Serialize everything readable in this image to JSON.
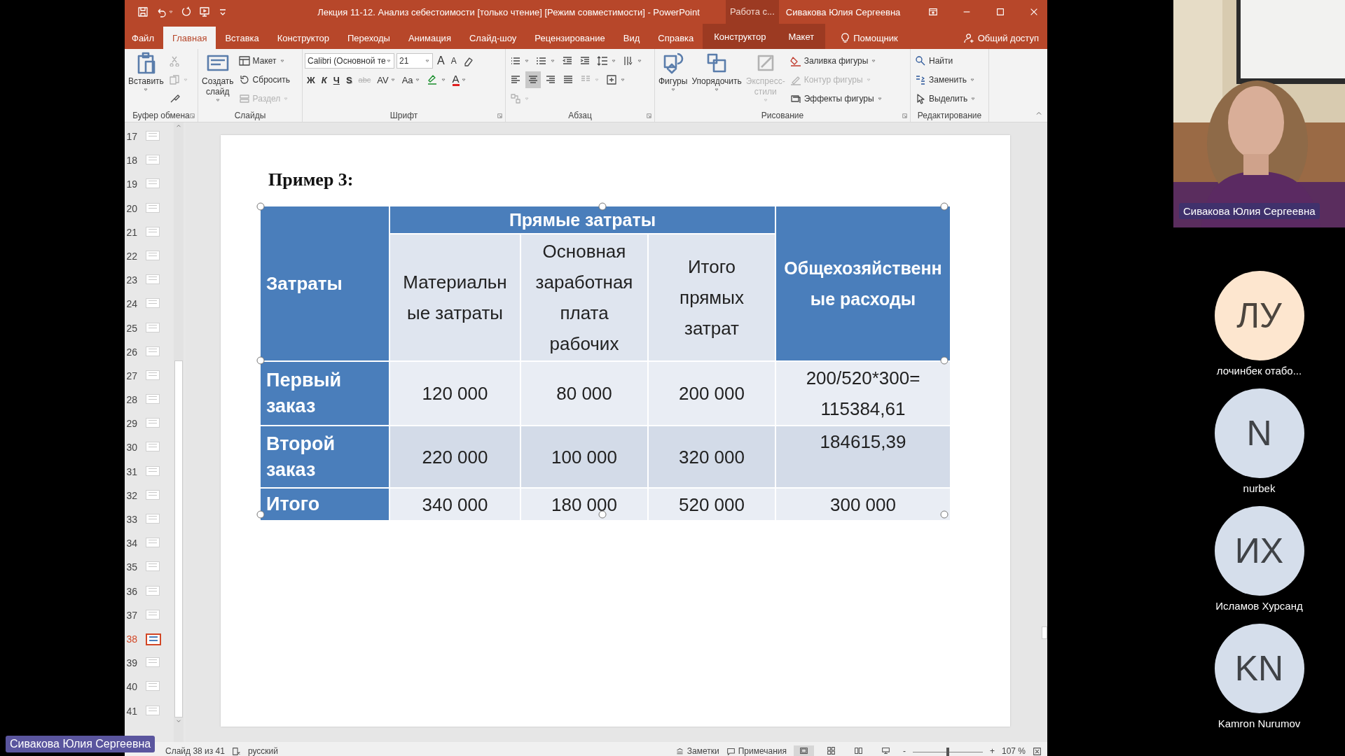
{
  "title_bar": {
    "title": "Лекция 11-12. Анализ себестоимости [только чтение] [Режим совместимости]  -  PowerPoint",
    "context_tab": "Работа с...",
    "user": "Сивакова Юлия Сергеевна"
  },
  "ribbon_tabs": [
    {
      "label": "Файл",
      "selected": false,
      "kind": "plain"
    },
    {
      "label": "Главная",
      "selected": true,
      "kind": "plain"
    },
    {
      "label": "Вставка",
      "selected": false,
      "kind": "plain"
    },
    {
      "label": "Конструктор",
      "selected": false,
      "kind": "plain"
    },
    {
      "label": "Переходы",
      "selected": false,
      "kind": "plain"
    },
    {
      "label": "Анимация",
      "selected": false,
      "kind": "plain"
    },
    {
      "label": "Слайд-шоу",
      "selected": false,
      "kind": "plain"
    },
    {
      "label": "Рецензирование",
      "selected": false,
      "kind": "plain"
    },
    {
      "label": "Вид",
      "selected": false,
      "kind": "plain"
    },
    {
      "label": "Справка",
      "selected": false,
      "kind": "plain"
    },
    {
      "label": "Конструктор",
      "selected": false,
      "kind": "context"
    },
    {
      "label": "Макет",
      "selected": false,
      "kind": "context"
    },
    {
      "label": "Помощник",
      "selected": false,
      "kind": "help"
    }
  ],
  "share": "Общий доступ",
  "ribbon": [
    {
      "label": "Буфер обмена",
      "launcher": true,
      "large": [
        {
          "kind": "paste",
          "label": "Вставить",
          "dropdown": true,
          "disabled": false
        }
      ],
      "lines": [
        {
          "items": [
            {
              "kind": "cut",
              "disabled": true
            }
          ]
        },
        {
          "items": [
            {
              "kind": "copy",
              "dropdown": true,
              "disabled": true
            }
          ]
        },
        {
          "items": [
            {
              "kind": "brush",
              "disabled": false
            }
          ]
        }
      ]
    },
    {
      "label": "Слайды",
      "large": [
        {
          "kind": "slide",
          "label": "Создать слайд",
          "dropdown": true,
          "disabled": false
        }
      ],
      "lines": [
        {
          "items": [
            {
              "kind": "layout",
              "label": "Макет",
              "dropdown": true,
              "disabled": false
            }
          ]
        },
        {
          "items": [
            {
              "kind": "reset",
              "label": "Сбросить",
              "disabled": false
            }
          ]
        },
        {
          "items": [
            {
              "kind": "section",
              "label": "Раздел",
              "dropdown": true,
              "disabled": true
            }
          ]
        }
      ]
    },
    {
      "label": "Шрифт",
      "launcher": true,
      "lines": [
        {
          "items": [
            {
              "kind": "field",
              "value": "Calibri (Основной те"
            },
            {
              "kind": "field",
              "value": "21"
            },
            {
              "kind": "grow",
              "label": "A",
              "disabled": false
            },
            {
              "kind": "shrink",
              "label": "A",
              "disabled": false
            },
            {
              "kind": "clear",
              "disabled": false
            }
          ]
        },
        {
          "items": [
            {
              "kind": "bold",
              "label": "Ж",
              "disabled": false
            },
            {
              "kind": "italic",
              "label": "К",
              "disabled": false
            },
            {
              "kind": "underline",
              "label": "Ч",
              "disabled": false
            },
            {
              "kind": "shadow",
              "label": "S",
              "disabled": false
            },
            {
              "kind": "strike",
              "label": "abc",
              "disabled": true
            },
            {
              "kind": "charspacing",
              "label": "AV",
              "dropdown": true,
              "disabled": false
            },
            {
              "kind": "case",
              "label": "Aa",
              "dropdown": true,
              "disabled": false
            },
            {
              "kind": "highlight",
              "dropdown": true,
              "disabled": false
            },
            {
              "kind": "fontcolor",
              "label": "A",
              "dropdown": true,
              "disabled": false
            }
          ]
        }
      ]
    },
    {
      "label": "Абзац",
      "launcher": true,
      "lines": [
        {
          "items": [
            {
              "kind": "bullets",
              "dropdown": true,
              "disabled": false
            },
            {
              "kind": "numbering",
              "dropdown": true,
              "disabled": false
            },
            {
              "kind": "outdent",
              "disabled": false
            },
            {
              "kind": "indent",
              "disabled": false
            },
            {
              "kind": "linespacing",
              "dropdown": true,
              "disabled": false
            },
            {
              "kind": "textdir",
              "dropdown": true,
              "disabled": false
            }
          ]
        },
        {
          "items": [
            {
              "kind": "align-left",
              "selected": false,
              "disabled": false
            },
            {
              "kind": "align-center",
              "selected": true,
              "disabled": false
            },
            {
              "kind": "align-right",
              "selected": false,
              "disabled": false
            },
            {
              "kind": "justify",
              "selected": false,
              "disabled": false
            },
            {
              "kind": "columns",
              "dropdown": true,
              "selected": false,
              "disabled": true
            },
            {
              "kind": "aligntext",
              "dropdown": true,
              "selected": false,
              "disabled": false
            }
          ]
        },
        {
          "items": [
            {
              "kind": "smartart",
              "dropdown": true,
              "disabled": true
            }
          ]
        }
      ]
    },
    {
      "label": "Рисование",
      "launcher": true,
      "large": [
        {
          "kind": "shapes",
          "label": "Фигуры",
          "dropdown": true,
          "disabled": false
        },
        {
          "kind": "arrange",
          "label": "Упорядочить",
          "dropdown": true,
          "disabled": false
        },
        {
          "kind": "styles",
          "label": "Экспресс-стили",
          "dropdown": true,
          "disabled": true
        }
      ],
      "lines": [
        {
          "items": [
            {
              "kind": "fill",
              "label": "Заливка фигуры",
              "dropdown": true,
              "disabled": false
            }
          ]
        },
        {
          "items": [
            {
              "kind": "outline",
              "label": "Контур фигуры",
              "dropdown": true,
              "disabled": true
            }
          ]
        },
        {
          "items": [
            {
              "kind": "effects",
              "label": "Эффекты фигуры",
              "dropdown": true,
              "disabled": false
            }
          ]
        }
      ]
    },
    {
      "label": "Редактирование",
      "lines": [
        {
          "items": [
            {
              "kind": "find",
              "label": "Найти",
              "disabled": false
            }
          ]
        },
        {
          "items": [
            {
              "kind": "replace",
              "label": "Заменить",
              "dropdown": true,
              "disabled": false
            }
          ]
        },
        {
          "items": [
            {
              "kind": "select",
              "label": "Выделить",
              "dropdown": true,
              "disabled": false
            }
          ]
        }
      ]
    }
  ],
  "thumbnails": [
    {
      "number": "17",
      "selected": false
    },
    {
      "number": "18",
      "selected": false
    },
    {
      "number": "19",
      "selected": false
    },
    {
      "number": "20",
      "selected": false
    },
    {
      "number": "21",
      "selected": false
    },
    {
      "number": "22",
      "selected": false
    },
    {
      "number": "23",
      "selected": false
    },
    {
      "number": "24",
      "selected": false
    },
    {
      "number": "25",
      "selected": false
    },
    {
      "number": "26",
      "selected": false
    },
    {
      "number": "27",
      "selected": false
    },
    {
      "number": "28",
      "selected": false
    },
    {
      "number": "29",
      "selected": false
    },
    {
      "number": "30",
      "selected": false
    },
    {
      "number": "31",
      "selected": false
    },
    {
      "number": "32",
      "selected": false
    },
    {
      "number": "33",
      "selected": false
    },
    {
      "number": "34",
      "selected": false
    },
    {
      "number": "35",
      "selected": false
    },
    {
      "number": "36",
      "selected": false
    },
    {
      "number": "37",
      "selected": false
    },
    {
      "number": "38",
      "selected": true
    },
    {
      "number": "39",
      "selected": false
    },
    {
      "number": "40",
      "selected": false
    },
    {
      "number": "41",
      "selected": false
    }
  ],
  "slide": {
    "title": "Пример 3:",
    "table": {
      "corner": "Затраты",
      "group_header": "Прямые затраты",
      "sub_headers": [
        "Материальные затраты",
        "Основная заработная плата рабочих",
        "Итого прямых затрат"
      ],
      "last_header": "Общехозяйственные расходы",
      "rows": [
        {
          "label": "Первый заказ",
          "cells": [
            "120 000",
            "80 000",
            "200 000",
            "200/520*300= 115384,61"
          ]
        },
        {
          "label": "Второй заказ",
          "cells": [
            "220 000",
            "100 000",
            "320 000",
            "184615,39"
          ]
        },
        {
          "label": "Итого",
          "cells": [
            "340 000",
            "180 000",
            "520 000",
            "300 000"
          ]
        }
      ]
    }
  },
  "status_bar": {
    "slide": "Слайд 38 из 41",
    "language": "русский",
    "notes": "Заметки",
    "comments": "Примечания",
    "views": [
      {
        "kind": "normal",
        "selected": true
      },
      {
        "kind": "sorter",
        "selected": false
      },
      {
        "kind": "reading",
        "selected": false
      },
      {
        "kind": "slideshow",
        "selected": false
      }
    ],
    "zoom_out": "-",
    "zoom_in": "+",
    "zoom": {
      "level": 0.5
    },
    "zoom_reading": "107 %"
  },
  "meeting": {
    "speaker": {
      "name": "Сивакова Юлия Сергеевна"
    },
    "self_label": "Сивакова Юлия Сергеевна",
    "participants": [
      {
        "initials": "ЛУ",
        "name": "лочинбек отабо...",
        "color": "#fde6cf"
      },
      {
        "initials": "N",
        "name": "nurbek",
        "color": "#d5deeb"
      },
      {
        "initials": "ИХ",
        "name": "Исламов Хурсанд",
        "color": "#d5deeb"
      },
      {
        "initials": "KN",
        "name": "Kamron Nurumov",
        "color": "#d5deeb"
      }
    ]
  }
}
